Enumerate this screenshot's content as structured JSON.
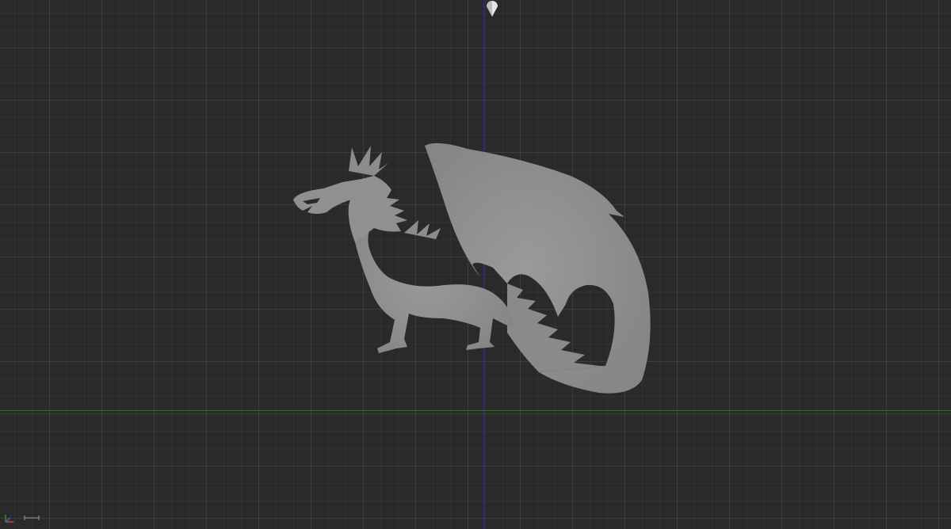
{
  "viewport": {
    "background_color": "#2a2a2a",
    "grid_color": "#3a3a3a",
    "axis_x_color": "#2f6a2f",
    "axis_y_color": "#35357a",
    "model_color": "#8e8e8e"
  },
  "model": {
    "icon": "dragon-model"
  },
  "camera_marker": {
    "icon": "camera-pin-icon"
  },
  "gizmo": {
    "icon": "axis-gizmo-icon"
  },
  "scale_bar": {
    "icon": "scale-bar-icon"
  }
}
